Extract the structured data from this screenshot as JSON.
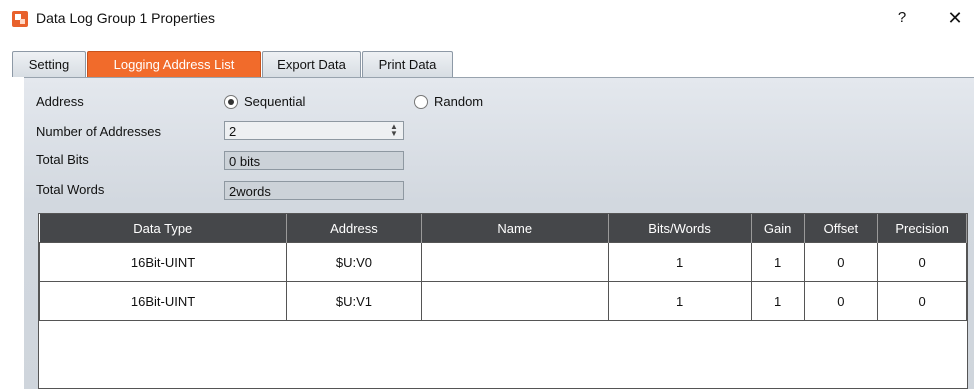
{
  "window": {
    "title": "Data Log Group 1 Properties",
    "help_label": "?",
    "close_label": "✕"
  },
  "tabs": [
    {
      "label": "Setting",
      "active": false
    },
    {
      "label": "Logging Address List",
      "active": true
    },
    {
      "label": "Export Data",
      "active": false
    },
    {
      "label": "Print Data",
      "active": false
    }
  ],
  "form": {
    "address_label": "Address",
    "address_options": [
      {
        "label": "Sequential",
        "checked": true
      },
      {
        "label": "Random",
        "checked": false
      }
    ],
    "number_of_addresses_label": "Number of Addresses",
    "number_of_addresses_value": "2",
    "total_bits_label": "Total Bits",
    "total_bits_value": "0 bits",
    "total_words_label": "Total Words",
    "total_words_value": "2words"
  },
  "table": {
    "columns": [
      "Data Type",
      "Address",
      "Name",
      "Bits/Words",
      "Gain",
      "Offset",
      "Precision"
    ],
    "rows": [
      [
        "16Bit-UINT",
        "$U:V0",
        "",
        "1",
        "1",
        "0",
        "0"
      ],
      [
        "16Bit-UINT",
        "$U:V1",
        "",
        "1",
        "1",
        "0",
        "0"
      ]
    ]
  },
  "colors": {
    "accent": "#f16b2b",
    "header_bg": "#45474a",
    "panel_bg": "#d2d8df"
  }
}
